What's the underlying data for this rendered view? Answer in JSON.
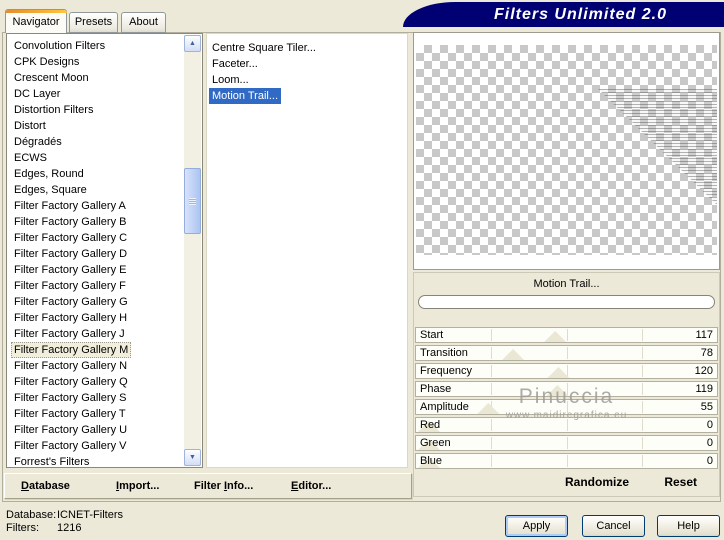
{
  "window": {
    "title": "Filters Unlimited 2.0"
  },
  "tabs": [
    {
      "label": "Navigator",
      "active": true
    },
    {
      "label": "Presets",
      "active": false
    },
    {
      "label": "About",
      "active": false
    }
  ],
  "category_list": {
    "items": [
      "Convolution Filters",
      "CPK Designs",
      "Crescent Moon",
      "DC Layer",
      "Distortion Filters",
      "Distort",
      "Dégradés",
      "ECWS",
      "Edges, Round",
      "Edges, Square",
      "Filter Factory Gallery A",
      "Filter Factory Gallery B",
      "Filter Factory Gallery C",
      "Filter Factory Gallery D",
      "Filter Factory Gallery E",
      "Filter Factory Gallery F",
      "Filter Factory Gallery G",
      "Filter Factory Gallery H",
      "Filter Factory Gallery J",
      "Filter Factory Gallery M",
      "Filter Factory Gallery N",
      "Filter Factory Gallery Q",
      "Filter Factory Gallery S",
      "Filter Factory Gallery T",
      "Filter Factory Gallery U",
      "Filter Factory Gallery V",
      "Forrest's Filters"
    ],
    "selected_item": "Filter Factory Gallery M"
  },
  "filter_list": {
    "items": [
      "Centre Square Tiler...",
      "Faceter...",
      "Loom...",
      "Motion Trail..."
    ],
    "selected_item": "Motion Trail..."
  },
  "preview": {
    "effect_label": "Motion Trail...",
    "progress_value": 0
  },
  "sliders": {
    "max": 255,
    "rows": [
      {
        "label": "Start",
        "value": 117
      },
      {
        "label": "Transition",
        "value": 78
      },
      {
        "label": "Frequency",
        "value": 120
      },
      {
        "label": "Phase",
        "value": 119
      },
      {
        "label": "Amplitude",
        "value": 55
      },
      {
        "label": "Red",
        "value": 0
      },
      {
        "label": "Green",
        "value": 0
      },
      {
        "label": "Blue",
        "value": 0
      }
    ]
  },
  "watermark": {
    "line1": "Pinuccia",
    "line2": "www.maidiregrafica.eu"
  },
  "actions": {
    "randomize": "Randomize",
    "reset": "Reset"
  },
  "toolbar": {
    "items": [
      {
        "pre": "",
        "u": "D",
        "post": "atabase"
      },
      {
        "pre": "",
        "u": "I",
        "post": "mport..."
      },
      {
        "pre": "Filter ",
        "u": "I",
        "post": "nfo..."
      },
      {
        "pre": "",
        "u": "E",
        "post": "ditor..."
      }
    ]
  },
  "status": {
    "database_label": "Database:",
    "database_value": "ICNET-Filters",
    "filters_label": "Filters:",
    "filters_value": "1216"
  },
  "buttons": {
    "apply": "Apply",
    "cancel": "Cancel",
    "help": "Help"
  },
  "icons": {
    "scroll_up_glyph": "▲",
    "scroll_down_glyph": "▼"
  },
  "colors": {
    "dialog_bg": "#ECE9D8",
    "banner_navy": "#000072",
    "selection_blue": "#316AC5",
    "tab_accent_orange": "#F2A814",
    "selected_category_bg": "#F2EEDC"
  }
}
